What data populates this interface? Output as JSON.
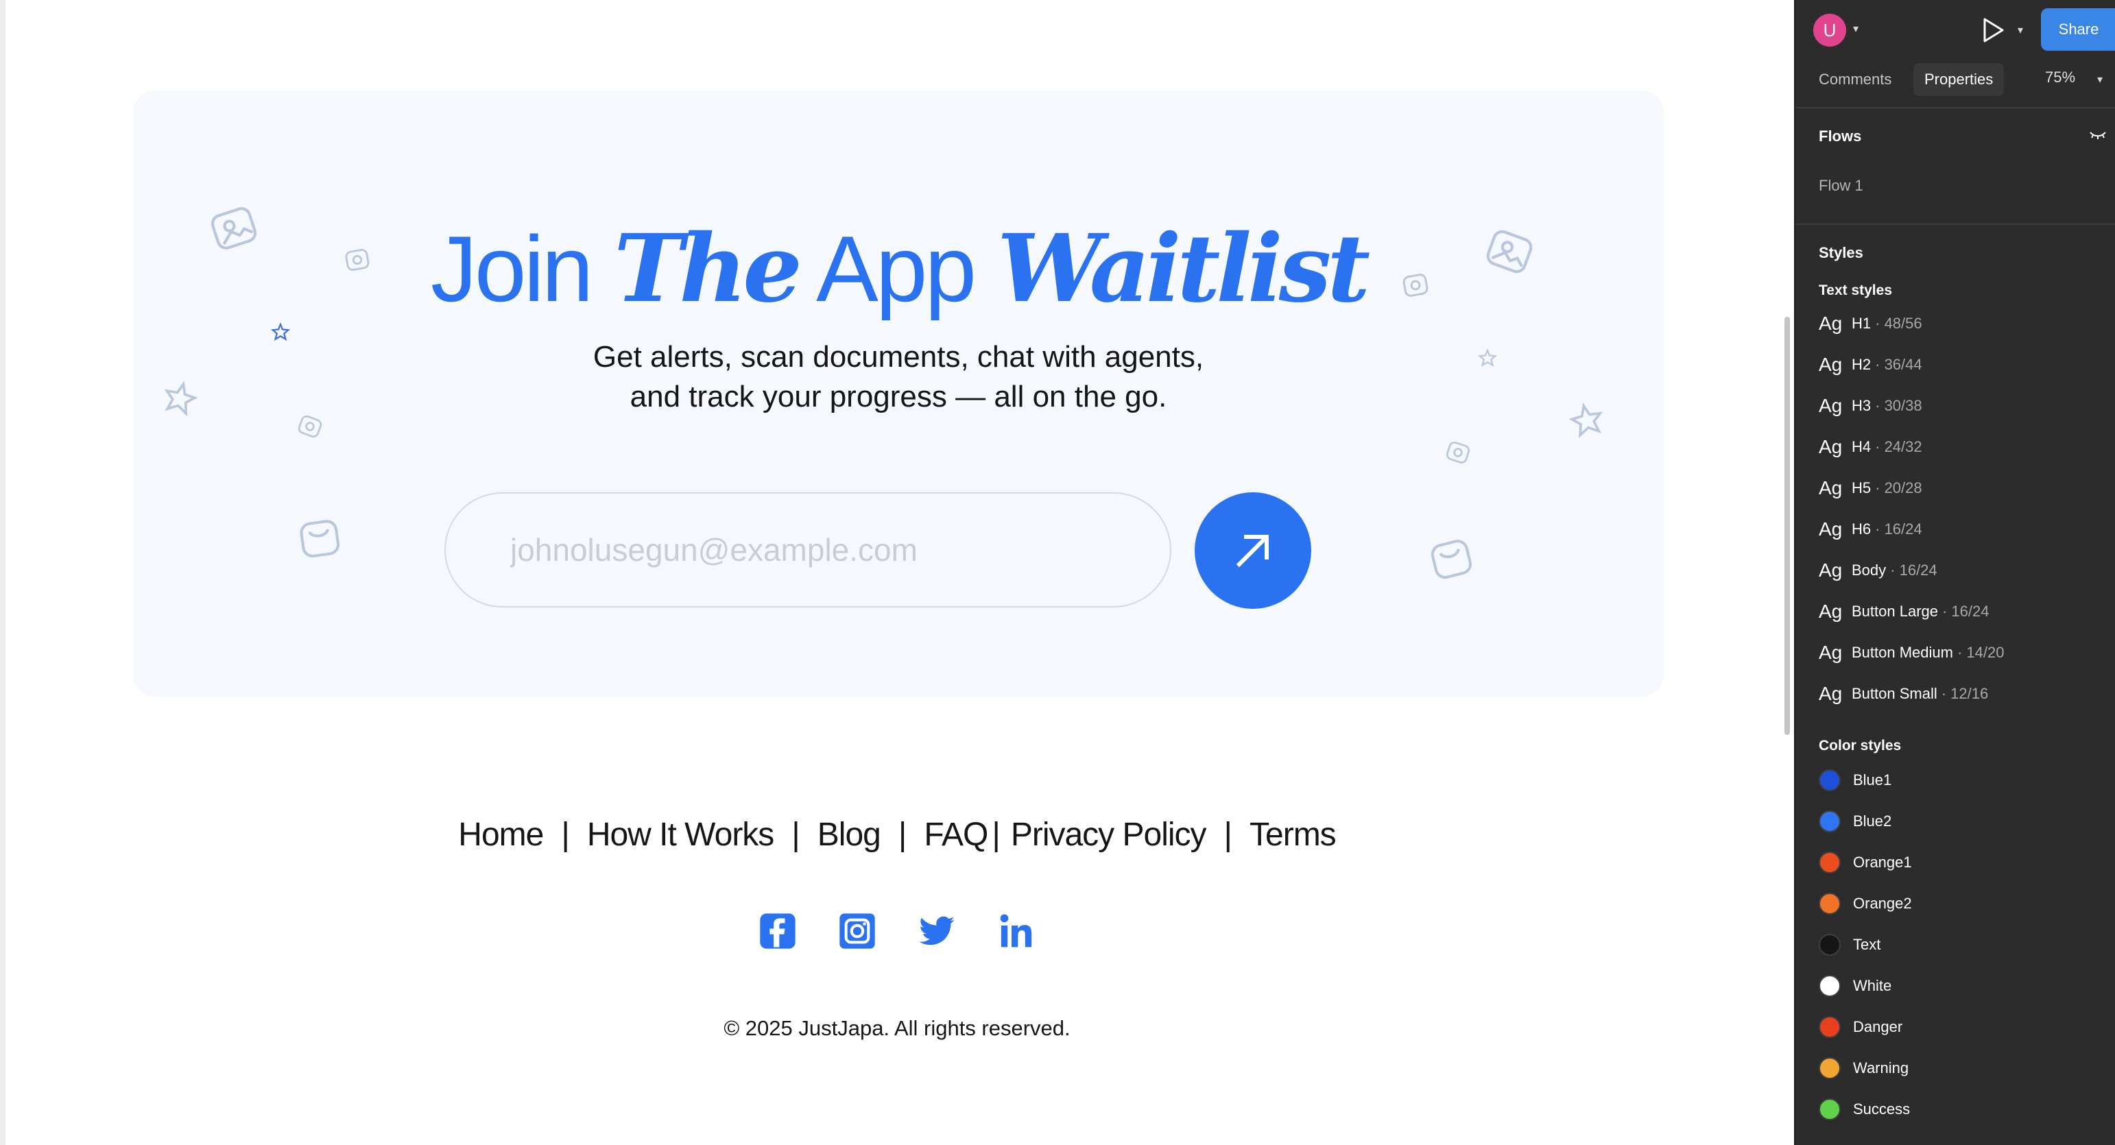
{
  "landing": {
    "headline_part1": "Join ",
    "headline_part2": "The",
    "headline_part3": " App ",
    "headline_part4": "Waitlist",
    "subtitle_line1": "Get alerts, scan documents, chat with agents,",
    "subtitle_line2": "and track your progress — all on the go.",
    "email_placeholder": "johnolusegun@example.com",
    "submit_icon": "arrow-up-right-icon",
    "accent_color": "#2a72f0"
  },
  "footer": {
    "nav": [
      {
        "label": "Home"
      },
      {
        "label": "How It Works"
      },
      {
        "label": "Blog"
      },
      {
        "label": "FAQ"
      },
      {
        "label": "Privacy Policy"
      },
      {
        "label": "Terms"
      }
    ],
    "separator": "|",
    "socials": [
      "facebook-icon",
      "instagram-icon",
      "twitter-icon",
      "linkedin-icon"
    ],
    "copyright": "© 2025 JustJapa. All rights reserved."
  },
  "panel": {
    "avatar_initial": "U",
    "share_label": "Share",
    "tabs": [
      {
        "label": "Comments"
      },
      {
        "label": "Properties"
      }
    ],
    "active_tab": "Properties",
    "zoom": "75%",
    "flows_title": "Flows",
    "flows": [
      {
        "label": "Flow 1"
      }
    ],
    "styles_title": "Styles",
    "text_styles_title": "Text styles",
    "ag_label": "Ag",
    "text_styles": [
      {
        "name": "H1",
        "meta": "· 48/56"
      },
      {
        "name": "H2",
        "meta": "· 36/44"
      },
      {
        "name": "H3",
        "meta": "· 30/38"
      },
      {
        "name": "H4",
        "meta": "· 24/32"
      },
      {
        "name": "H5",
        "meta": "· 20/28"
      },
      {
        "name": "H6",
        "meta": "· 16/24"
      },
      {
        "name": "Body",
        "meta": "· 16/24"
      },
      {
        "name": "Button Large",
        "meta": "· 16/24"
      },
      {
        "name": "Button Medium",
        "meta": "· 14/20"
      },
      {
        "name": "Button Small",
        "meta": "· 12/16"
      }
    ],
    "color_styles_title": "Color styles",
    "color_styles": [
      {
        "name": "Blue1",
        "color": "#1d4fd8"
      },
      {
        "name": "Blue2",
        "color": "#2f74f0"
      },
      {
        "name": "Orange1",
        "color": "#ea4d1f"
      },
      {
        "name": "Orange2",
        "color": "#f07328"
      },
      {
        "name": "Text",
        "color": "#161616"
      },
      {
        "name": "White",
        "color": "#ffffff"
      },
      {
        "name": "Danger",
        "color": "#e8401f"
      },
      {
        "name": "Warning",
        "color": "#f3a531"
      },
      {
        "name": "Success",
        "color": "#5fd14a"
      }
    ]
  }
}
